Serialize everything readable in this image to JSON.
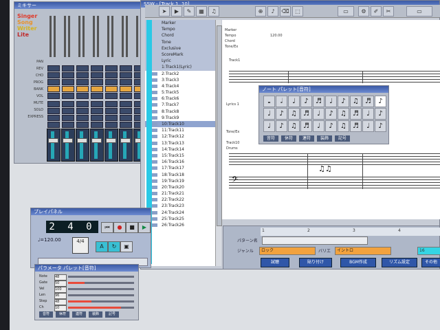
{
  "mixer": {
    "title": "ミキサー",
    "logo": [
      "Singer",
      "Song",
      "Writer",
      "Lite"
    ],
    "row_labels": [
      "PAN",
      "REV",
      "CHO",
      "PROG",
      "BANK",
      "VOL",
      "MUTE",
      "SOLO",
      "EXPRESS"
    ]
  },
  "main": {
    "title": "SSW - [Track 1, 10]",
    "header_labels": [
      "Marker",
      "Tempo",
      "Chord",
      "Tone",
      "Exclusive",
      "ScoreMark",
      "Lyric"
    ],
    "tracks": [
      "1:Track1(Lyric)",
      "2:Track2",
      "3:Track3",
      "4:Track4",
      "5:Track5",
      "6:Track6",
      "7:Track7",
      "8:Track8",
      "9:Track9",
      "10:Track10",
      "11:Track11",
      "12:Track12",
      "13:Track13",
      "14:Track14",
      "15:Track15",
      "16:Track16",
      "17:Track17",
      "18:Track18",
      "19:Track19",
      "20:Track20",
      "21:Track21",
      "22:Track22",
      "23:Track23",
      "24:Track24",
      "25:Track25",
      "26:Track26"
    ],
    "score_labels": {
      "marker": "Marker",
      "tempo": "Tempo",
      "tempo_value": "120.00",
      "chord": "Chord",
      "tone": "Tone/Ex",
      "track1": "Track1",
      "lyrics": "Lyrics 1",
      "track10": "Track10",
      "drums": "Drums"
    }
  },
  "note_palette": {
    "title": "ノート パレット[音符]",
    "tabs": [
      "音符",
      "休符",
      "連符",
      "装飾",
      "記号"
    ]
  },
  "bottom_panel": {
    "ruler": [
      "1",
      "2",
      "3",
      "4"
    ],
    "pattern_label": "パターン名",
    "genre_label": "ジャンル",
    "genre_value": "ロック",
    "variation_label": "バリエ",
    "variation_value": "イントロ",
    "count_value": "16",
    "buttons": [
      "試聴",
      "貼り付け",
      "BGM作成",
      "リズム設定",
      "その他"
    ]
  },
  "player": {
    "title": "プレイパネル",
    "position": "2 4 0",
    "tempo": "♩=120.00",
    "time_signature": "4/4"
  },
  "param_palette": {
    "title": "パラメータ パレット[音符]",
    "rows": [
      {
        "label": "Note",
        "value": "48",
        "level": 0.0
      },
      {
        "label": "Gate",
        "value": "50",
        "level": 0.25
      },
      {
        "label": "Vel",
        "value": "100",
        "level": 0.0
      },
      {
        "label": "Len",
        "value": "96",
        "level": 0.0
      },
      {
        "label": "Step",
        "value": "48",
        "level": 0.35
      },
      {
        "label": "Ch",
        "value": "10",
        "level": 0.8
      }
    ],
    "tabs": [
      "音符",
      "休符",
      "連符",
      "装飾",
      "記号"
    ]
  }
}
